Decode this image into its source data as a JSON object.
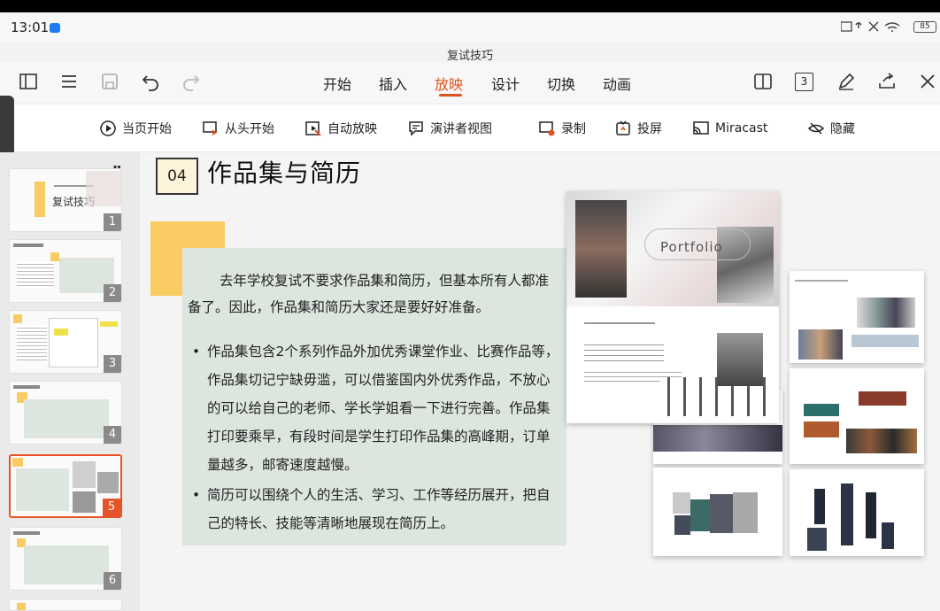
{
  "status": {
    "time": "13:01",
    "battery": "85"
  },
  "document": {
    "title": "复试技巧"
  },
  "toolbar": {
    "tabs": [
      {
        "label": "开始"
      },
      {
        "label": "插入"
      },
      {
        "label": "放映"
      },
      {
        "label": "设计"
      },
      {
        "label": "切换"
      },
      {
        "label": "动画"
      }
    ],
    "active_tab": "放映",
    "page_count_label": "3"
  },
  "ribbon": {
    "items": [
      {
        "label": "当页开始",
        "icon": "play-circle-icon"
      },
      {
        "label": "从头开始",
        "icon": "play-from-start-icon"
      },
      {
        "label": "自动放映",
        "icon": "auto-play-icon"
      },
      {
        "label": "演讲者视图",
        "icon": "presenter-view-icon"
      },
      {
        "label": "录制",
        "icon": "record-icon"
      },
      {
        "label": "投屏",
        "icon": "cast-screen-icon"
      },
      {
        "label": "Miracast",
        "icon": "miracast-icon"
      },
      {
        "label": "隐藏",
        "icon": "hide-eye-icon"
      }
    ]
  },
  "sidebar": {
    "quote": "”",
    "slides": [
      {
        "number": "1",
        "title": "复试技巧"
      },
      {
        "number": "2"
      },
      {
        "number": "3"
      },
      {
        "number": "4"
      },
      {
        "number": "5",
        "selected": true
      },
      {
        "number": "6"
      }
    ]
  },
  "slide": {
    "badge": "04",
    "title": "作品集与简历",
    "intro": "去年学校复试不要求作品集和简历，但基本所有人都准备了。因此，作品集和简历大家还是要好好准备。",
    "bullets": [
      "作品集包含2个系列作品外加优秀课堂作业、比赛作品等，作品集切记宁缺毋滥，可以借鉴国内外优秀作品，不放心的可以给自己的老师、学长学姐看一下进行完善。作品集打印要乘早，有段时间是学生打印作品集的高峰期，订单量越多，邮寄速度越慢。",
      "简历可以围绕个人的生活、学习、工作等经历展开，把自己的特长、技能等清晰地展现在简历上。"
    ],
    "portfolio_label": "Portfolio"
  },
  "colors": {
    "accent": "#e0531f",
    "panel": "#dce6df",
    "yellow": "#f8cc62"
  }
}
